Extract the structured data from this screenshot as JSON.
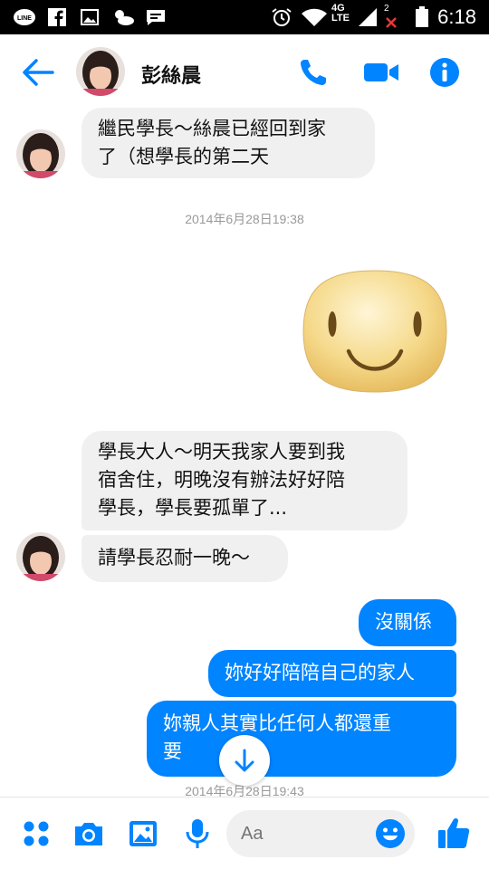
{
  "status_bar": {
    "time": "6:18",
    "network": "4G",
    "network_sub": "LTE",
    "sim_badge": "2"
  },
  "header": {
    "contact_name": "彭絲晨"
  },
  "messages": {
    "m1": [
      "繼民學長～絲晨已經回到家",
      "了（想學長的第二天"
    ],
    "ts1": "2014年6月28日19:38",
    "m2": [
      "學長大人～明天我家人要到我",
      "宿舍住，明晚沒有辦法好好陪",
      "學長，學長要孤單了..."
    ],
    "m3": "請學長忍耐一晚～",
    "m4": "沒關係",
    "m5": "妳好好陪陪自己的家人",
    "m6": [
      "妳親人其實比任何人都還重",
      "要"
    ],
    "ts2": "2014年6月28日19:43"
  },
  "composer": {
    "placeholder": "Aa"
  },
  "colors": {
    "accent": "#0084ff",
    "incoming_bubble": "#f1f0f0"
  }
}
